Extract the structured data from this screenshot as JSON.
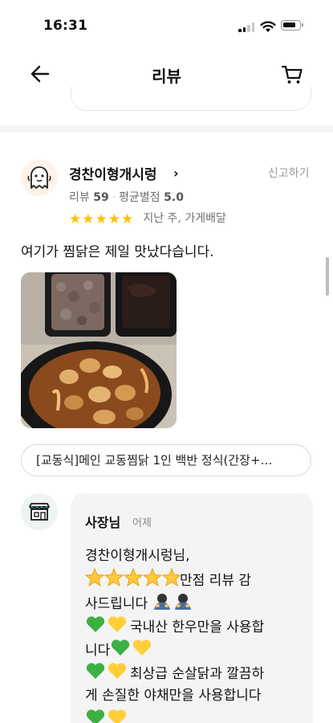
{
  "status_bar": {
    "time": "16:31"
  },
  "header": {
    "title": "리뷰",
    "back_icon": "arrow-left-icon",
    "cart_icon": "cart-icon"
  },
  "review": {
    "reviewer_name": "경찬이형개시렁",
    "chevron": "›",
    "report_label": "신고하기",
    "stats": {
      "review_label": "리뷰",
      "review_count": "59",
      "avg_label": "평균별점",
      "avg_rating": "5.0"
    },
    "rating": 5,
    "meta": "지난 주, 가게배달",
    "text": "여기가 찜닭은 제일 맛났다습니다.",
    "menu_chip": "[교동식]메인 교동찜닭 1인 백반 정식(간장+…"
  },
  "owner_reply": {
    "name": "사장님",
    "time": "어제",
    "lines": {
      "l1": "경찬이형개시렁님,",
      "l2_text": "만점 리뷰 감",
      "l3_text": "사드립니다",
      "l4_text": "국내산 한우만을 사용합",
      "l5_text": "니다",
      "l6_text": "최상급 순살닭과 깔끔하",
      "l7_text": "게 손질한 야채만을 사용합니다"
    }
  },
  "colors": {
    "star": "#ffc107",
    "muted_text": "#6f6f6f",
    "bubble_bg": "#f4f4f4",
    "green_heart": "#3cb043",
    "yellow_heart": "#ffcf3a"
  }
}
